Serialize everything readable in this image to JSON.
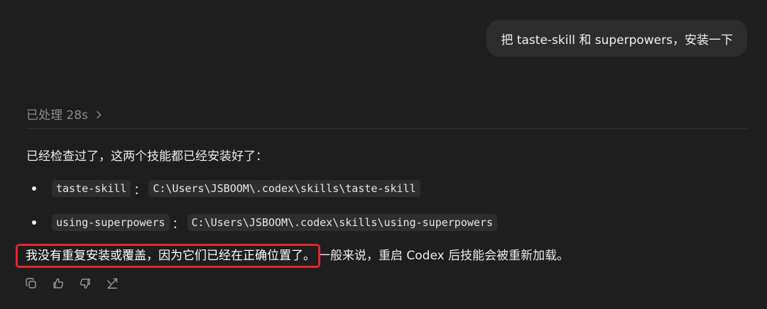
{
  "user_message": {
    "text": "把 taste-skill 和 superpowers，安装一下"
  },
  "assistant": {
    "processed_label": "已处理 28s",
    "summary": "已经检查过了，这两个技能都已经安装好了：",
    "items": [
      {
        "name": "taste-skill",
        "separator": "：",
        "path": "C:\\Users\\JSBOOM\\.codex\\skills\\taste-skill"
      },
      {
        "name": "using-superpowers",
        "separator": "：",
        "path": "C:\\Users\\JSBOOM\\.codex\\skills\\using-superpowers"
      }
    ],
    "closing_highlighted": "我没有重复安装或覆盖，因为它们已经在正确位置了。",
    "closing_rest": "一般来说，重启 Codex 后技能会被重新加载。"
  },
  "actions": [
    {
      "icon": "copy-icon"
    },
    {
      "icon": "thumbs-up-icon"
    },
    {
      "icon": "thumbs-down-icon"
    },
    {
      "icon": "share-icon"
    }
  ],
  "colors": {
    "background": "#1e1e1e",
    "bubble": "#2d2d2d",
    "highlight_border": "#e5262d",
    "muted_text": "#8c8c8c"
  }
}
